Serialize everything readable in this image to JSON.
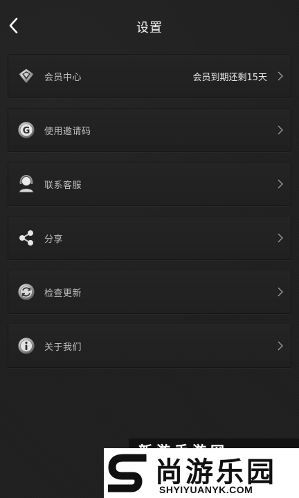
{
  "header": {
    "title": "设置",
    "back_icon": "back-arrow-icon"
  },
  "menu": [
    {
      "label": "会员中心",
      "value": "会员到期还剩15天",
      "icon": "diamond-icon"
    },
    {
      "label": "使用邀请码",
      "value": "",
      "icon": "invite-code-icon"
    },
    {
      "label": "联系客服",
      "value": "",
      "icon": "customer-service-icon"
    },
    {
      "label": "分享",
      "value": "",
      "icon": "share-icon"
    },
    {
      "label": "检查更新",
      "value": "",
      "icon": "update-icon"
    },
    {
      "label": "关于我们",
      "value": "",
      "icon": "info-icon"
    }
  ],
  "watermark": {
    "top_text": "新游手游网",
    "chinese": "尚游乐园",
    "english": "SHYIYUANYK.COM"
  },
  "colors": {
    "background": "#1f1f1f",
    "item_background": "#232323",
    "title_text": "#f2f2f2",
    "label_text": "#bfbfbf"
  }
}
